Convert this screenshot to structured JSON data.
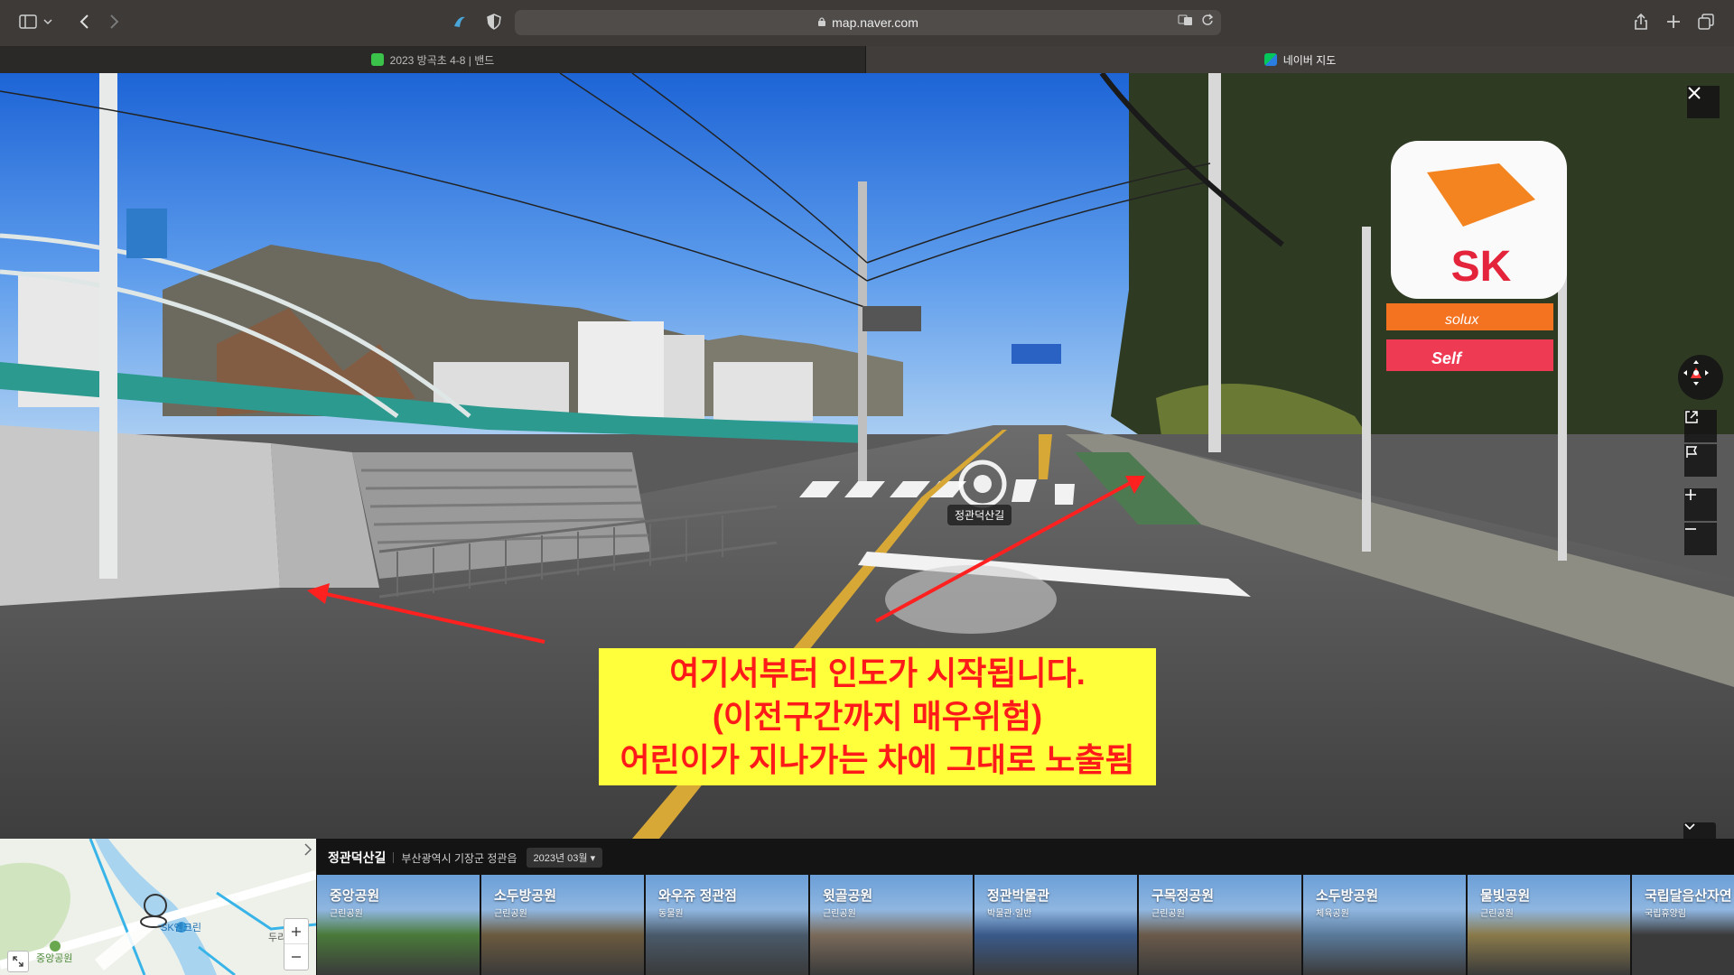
{
  "browser": {
    "url": "map.naver.com",
    "tabs": [
      {
        "label": "2023 방곡초 4-8 | 밴드"
      },
      {
        "label": "네이버 지도"
      }
    ]
  },
  "panorama": {
    "location_label": "정관덕산길",
    "annotation": {
      "line1": "여기서부터 인도가 시작됩니다.",
      "line2": "(이전구간까지  매우위험)",
      "line3": "어린이가 지나가는 차에 그대로 노출됨"
    },
    "sign_text": "SK",
    "sign_sub1": "solux",
    "sign_sub2": "Self"
  },
  "bottom_bar": {
    "place_name": "정관덕산길",
    "address": "부산광역시 기장군 정관읍",
    "date_selector": "2023년 03월",
    "minimap": {
      "labels": [
        "SK엔크린",
        "중앙공원",
        "두리"
      ]
    },
    "thumbnails": [
      {
        "title": "중앙공원",
        "subtitle": "근린공원",
        "color": "#4a7a3a"
      },
      {
        "title": "소두방공원",
        "subtitle": "근린공원",
        "color": "#6b5a3e"
      },
      {
        "title": "와우쥬 정관점",
        "subtitle": "동물원",
        "color": "#4a5a6a"
      },
      {
        "title": "윗골공원",
        "subtitle": "근린공원",
        "color": "#7a6a5a"
      },
      {
        "title": "정관박물관",
        "subtitle": "박물관·일반",
        "color": "#3a5a8a"
      },
      {
        "title": "구목정공원",
        "subtitle": "근린공원",
        "color": "#6a5a4a"
      },
      {
        "title": "소두방공원",
        "subtitle": "체육공원",
        "color": "#5a7a9a"
      },
      {
        "title": "물빛공원",
        "subtitle": "근린공원",
        "color": "#8a7a4a"
      },
      {
        "title": "국립달음산자연",
        "subtitle": "국립휴양림",
        "color": "#3a3a3a"
      }
    ]
  }
}
